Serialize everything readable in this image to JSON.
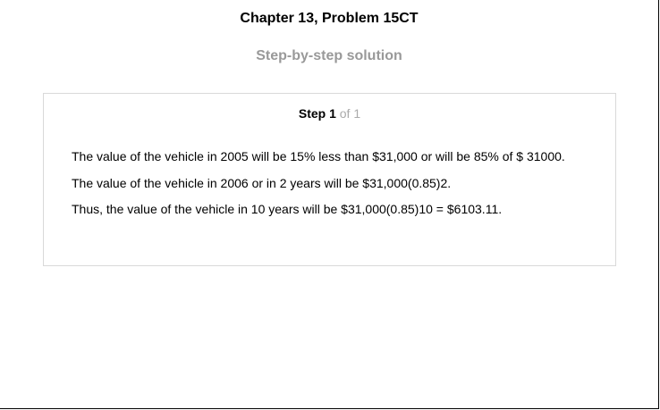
{
  "header": {
    "title": "Chapter 13, Problem 15CT",
    "subtitle": "Step-by-step solution"
  },
  "step": {
    "label": "Step 1",
    "of_text": " of 1",
    "lines": [
      "The value of the vehicle in 2005 will be 15% less than $31,000 or will be 85% of $ 31000.",
      "The value of the vehicle in 2006 or in 2 years will be $31,000(0.85)2.",
      "Thus, the value of the vehicle in 10 years will be $31,000(0.85)10 = $6103.11."
    ]
  }
}
